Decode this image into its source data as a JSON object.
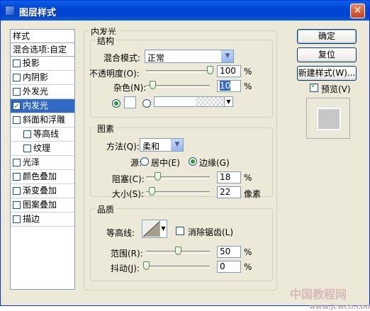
{
  "window": {
    "title": "图层样式",
    "close_glyph": "✕"
  },
  "left_list": {
    "header": "样式",
    "blend_options": "混合选项:自定",
    "items": [
      {
        "label": "投影",
        "checked": false,
        "selected": false,
        "indent": false
      },
      {
        "label": "内阴影",
        "checked": false,
        "selected": false,
        "indent": false
      },
      {
        "label": "外发光",
        "checked": false,
        "selected": false,
        "indent": false
      },
      {
        "label": "内发光",
        "checked": true,
        "selected": true,
        "indent": false
      },
      {
        "label": "斜面和浮雕",
        "checked": false,
        "selected": false,
        "indent": false
      },
      {
        "label": "等高线",
        "checked": false,
        "selected": false,
        "indent": true
      },
      {
        "label": "纹理",
        "checked": false,
        "selected": false,
        "indent": true
      },
      {
        "label": "光泽",
        "checked": false,
        "selected": false,
        "indent": false
      },
      {
        "label": "颜色叠加",
        "checked": false,
        "selected": false,
        "indent": false
      },
      {
        "label": "渐变叠加",
        "checked": false,
        "selected": false,
        "indent": false
      },
      {
        "label": "图案叠加",
        "checked": false,
        "selected": false,
        "indent": false
      },
      {
        "label": "描边",
        "checked": false,
        "selected": false,
        "indent": false
      }
    ]
  },
  "inner_glow": {
    "title": "内发光",
    "structure": {
      "title": "结构",
      "blend_mode_label": "混合模式:",
      "blend_mode_value": "正常",
      "opacity_label": "不透明度(O):",
      "opacity_value": "100",
      "opacity_unit": "%",
      "opacity_pct": 100,
      "noise_label": "杂色(N):",
      "noise_value": "10",
      "noise_unit": "%",
      "noise_pct": 10
    },
    "elements": {
      "title": "图素",
      "method_label": "方法(Q):",
      "method_value": "柔和",
      "source_label": "源:",
      "source_center": "居中(E)",
      "source_edge": "边缘(G)",
      "choke_label": "阻塞(C):",
      "choke_value": "18",
      "choke_unit": "%",
      "choke_pct": 18,
      "size_label": "大小(S):",
      "size_value": "22",
      "size_unit": "像素",
      "size_pct": 9
    },
    "quality": {
      "title": "品质",
      "contour_label": "等高线:",
      "anti_alias_label": "消除锯齿(L)",
      "range_label": "范围(R):",
      "range_value": "50",
      "range_unit": "%",
      "range_pct": 50,
      "jitter_label": "抖动(J):",
      "jitter_value": "0",
      "jitter_unit": "%",
      "jitter_pct": 0
    }
  },
  "buttons": {
    "ok": "确定",
    "reset": "复位",
    "new_style": "新建样式(W)...",
    "preview": "预览(V)"
  },
  "watermark": {
    "line1": "中国教程网",
    "line2": "www.jcwcn.com"
  }
}
